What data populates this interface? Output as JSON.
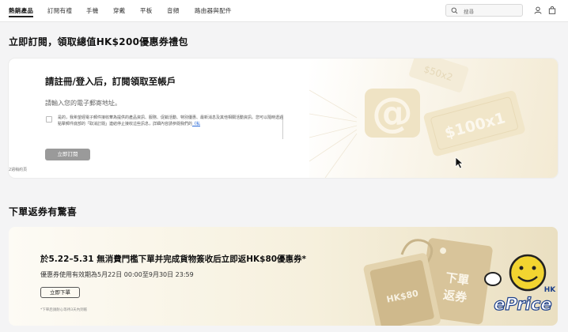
{
  "nav": {
    "items": [
      "熱銷產品",
      "訂閱有禮",
      "手機",
      "穿戴",
      "平板",
      "音頻",
      "路由器與配件"
    ],
    "search_placeholder": "搜尋"
  },
  "section1": {
    "title": "立即訂閱，領取總值HK$200優惠券禮包",
    "card_heading": "請註冊/登入后，訂閱領取至帳戶",
    "email_hint": "請輸入您的電子郵寄地址。",
    "consent_text": "是的，我希望經電子郵件接收華為提供的產品資訊、服務、促銷活動、特別優惠、最新消息及其他相關活動資訊。您可以隨時透過點擊郵件底部的「取消訂閱」連結停止接收這些訊息，詳細內容請參閱我們的",
    "consent_link": "《私",
    "subscribe_button": "立即訂閱",
    "note": "2週稍約頁",
    "coupon_big": "$100x1",
    "coupon_small": "$50x2"
  },
  "section2": {
    "title": "下單返券有驚喜",
    "heading": "於5.22–5.31 無消費門檻下單并完成貨物簽收后立即返HK$80優惠券*",
    "validity": "優惠券使用有效期為5月22日 00:00至9月30日 23:59",
    "order_button": "立即下單",
    "note": "*下單后請耐心等待3天內到帳",
    "coupon_value": "HK$80",
    "tag_text": [
      "下單",
      "返券"
    ]
  },
  "watermark": {
    "brand": "ePrice",
    "region": "HK"
  },
  "colors": {
    "accent": "#e8c33a",
    "card_bg": "#f6f0dd",
    "button_disabled": "#9a9a9a"
  }
}
